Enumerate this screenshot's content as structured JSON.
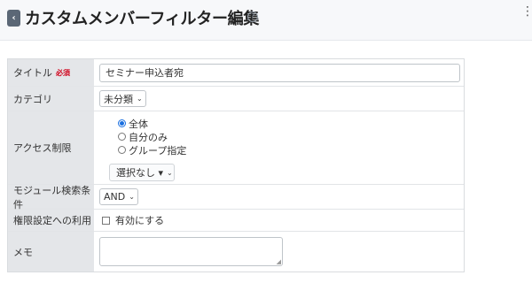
{
  "header": {
    "back_symbol": "‹",
    "title": "カスタムメンバーフィルター編集",
    "help_symbol": "?",
    "menu_symbol": "⋮"
  },
  "form": {
    "title_label": "タイトル",
    "required_badge": "必須",
    "title_value": "セミナー申込者宛",
    "category_label": "カテゴリ",
    "category_value": "未分類",
    "access_label": "アクセス制限",
    "access_options": [
      "全体",
      "自分のみ",
      "グループ指定"
    ],
    "access_selected": "全体",
    "group_select_label": "選択なし ▾",
    "module_label": "モジュール検索条件",
    "module_value": "AND",
    "permission_label": "権限設定への利用",
    "permission_checkbox_label": "有効にする",
    "memo_label": "メモ",
    "memo_value": ""
  },
  "icons": {
    "back": "chevron-left-icon",
    "help": "question-circle-icon",
    "menu": "vertical-dots-icon",
    "dropdown": "chevron-down-icon"
  },
  "colors": {
    "required": "#d0021b",
    "radio_accent": "#1a6fe0",
    "label_bg": "#e4e6e9",
    "back_button": "#5b6776"
  }
}
